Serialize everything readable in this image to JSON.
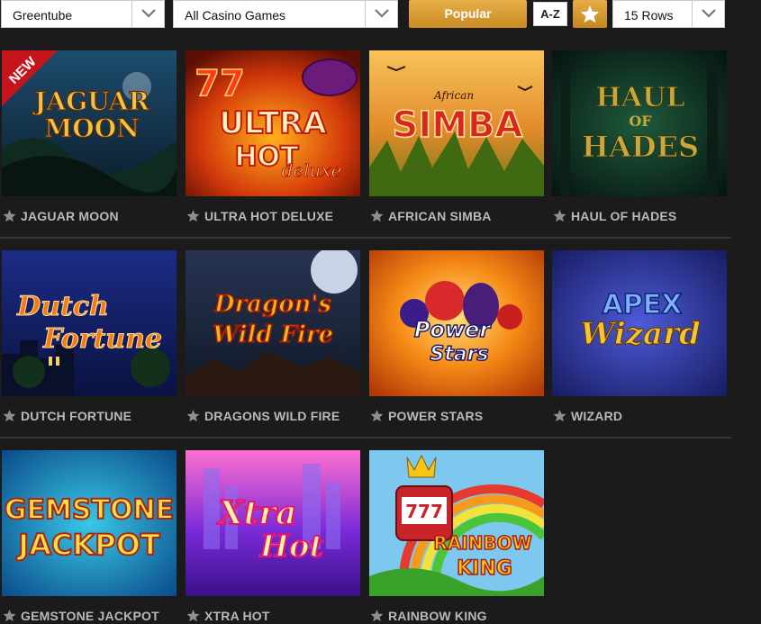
{
  "toolbar": {
    "provider": "Greentube",
    "category": "All Casino Games",
    "popular": "Popular",
    "az": "A-Z",
    "rows": "15 Rows"
  },
  "colors": {
    "accent": "#d89c32",
    "background": "#1b1b1b",
    "caption": "#b9b9b9",
    "divider": "#3d3629"
  },
  "games": [
    {
      "name": "JAGUAR MOON",
      "badge": "NEW",
      "art_title_1": "JAGUAR",
      "art_title_2": "MOON"
    },
    {
      "name": "ULTRA HOT DELUXE",
      "art_title_1": "77",
      "art_title_2": "ULTRA",
      "art_title_3": "HOT",
      "art_title_4": "deluxe"
    },
    {
      "name": "AFRICAN SIMBA",
      "art_title_1": "African",
      "art_title_2": "SIMBA"
    },
    {
      "name": "HAUL OF HADES",
      "art_title_1": "HAUL",
      "art_title_2": "OF",
      "art_title_3": "HADES"
    },
    {
      "name": "DUTCH FORTUNE",
      "art_title_1": "Dutch",
      "art_title_2": "Fortune"
    },
    {
      "name": "DRAGONS WILD FIRE",
      "art_title_1": "Dragon's",
      "art_title_2": "Wild Fire"
    },
    {
      "name": "POWER STARS",
      "art_title_1": "Power",
      "art_title_2": "Stars"
    },
    {
      "name": "WIZARD",
      "art_title_1": "APEX",
      "art_title_2": "Wizard"
    },
    {
      "name": "GEMSTONE JACKPOT",
      "art_title_1": "GEMSTONE",
      "art_title_2": "JACKPOT"
    },
    {
      "name": "XTRA HOT",
      "art_title_1": "Xtra",
      "art_title_2": "Hot"
    },
    {
      "name": "RAINBOW KING",
      "art_title_1": "RAINBOW",
      "art_title_2": "KING",
      "art_title_3": "777"
    }
  ]
}
